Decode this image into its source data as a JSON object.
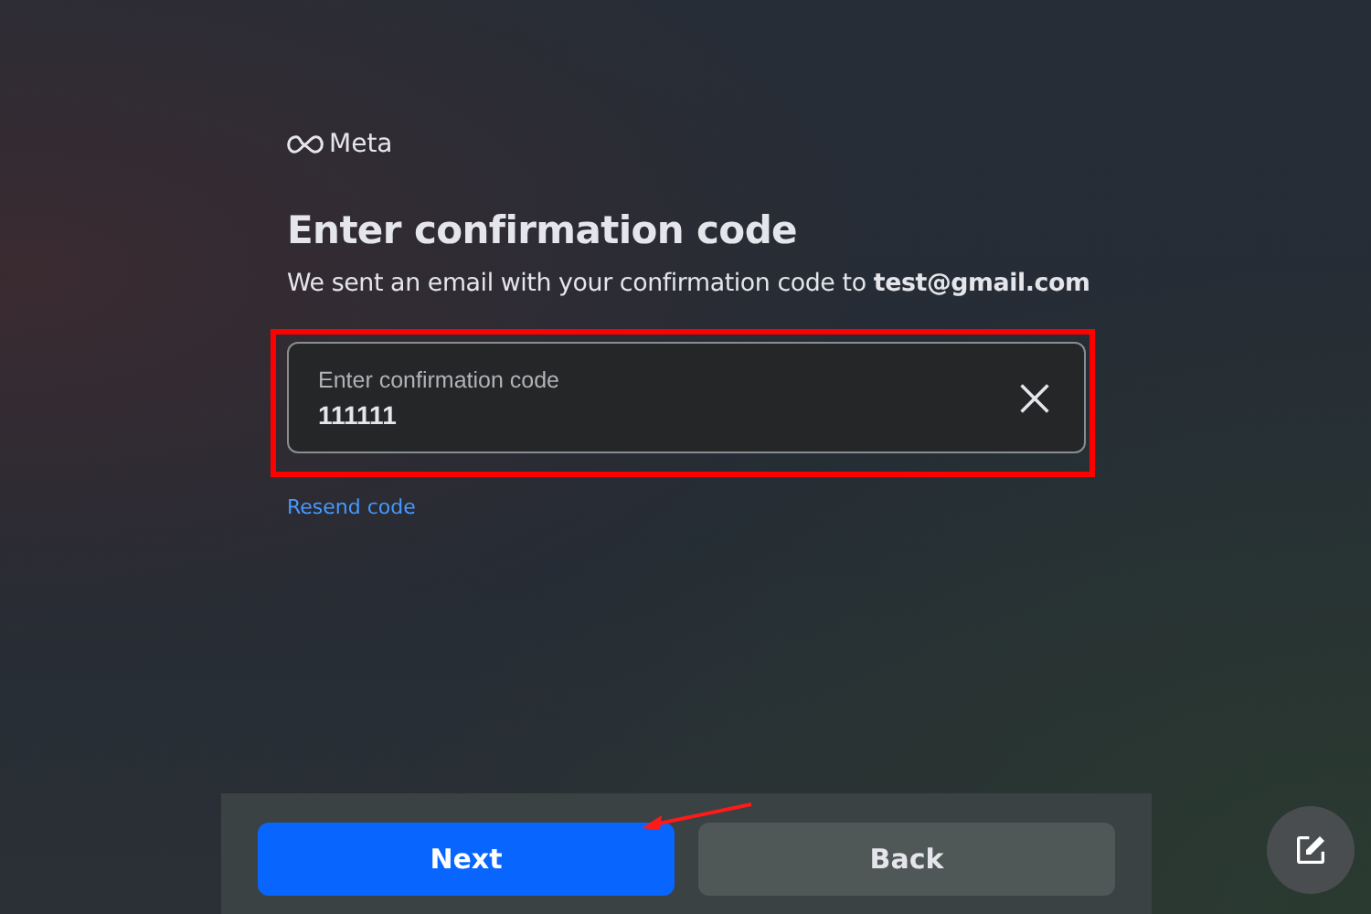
{
  "brand": {
    "name": "Meta"
  },
  "heading": "Enter confirmation code",
  "message": "We sent an email with your confirmation code to **test@gmail.com**",
  "code_field": {
    "label": "Enter confirmation code",
    "value": "111111"
  },
  "resend_link": "Resend code",
  "buttons": [
    {
      "label": "Next",
      "kind": "primary"
    },
    {
      "label": "Back",
      "kind": "secondary"
    }
  ]
}
